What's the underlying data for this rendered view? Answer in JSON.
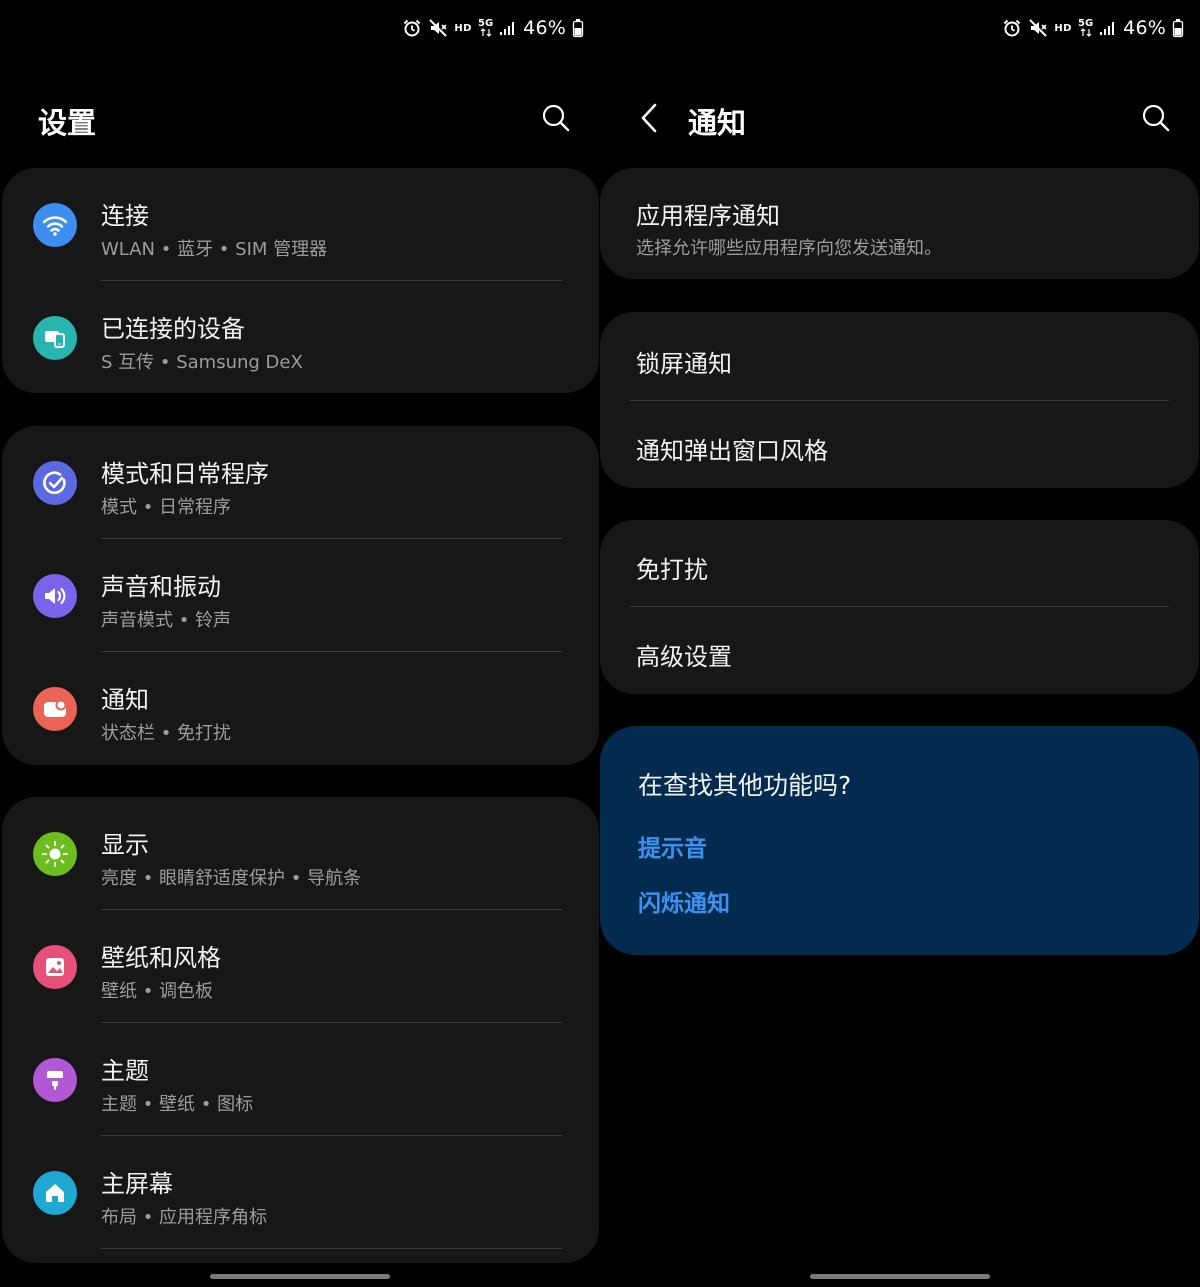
{
  "status_bar": {
    "network_hd": "HD",
    "network_5g": "5G",
    "battery_percent": "46%"
  },
  "settings_screen": {
    "title": "设置",
    "groups": [
      {
        "items": [
          {
            "title": "连接",
            "subtitle": "WLAN  •  蓝牙  •  SIM 管理器",
            "icon": "wifi-icon",
            "icon_color": "#3d8ef0"
          },
          {
            "title": "已连接的设备",
            "subtitle": "S 互传  •  Samsung DeX",
            "icon": "devices-icon",
            "icon_color": "#27b5b0"
          }
        ]
      },
      {
        "items": [
          {
            "title": "模式和日常程序",
            "subtitle": "模式  •  日常程序",
            "icon": "modes-check-icon",
            "icon_color": "#5b6ae0"
          },
          {
            "title": "声音和振动",
            "subtitle": "声音模式  •  铃声",
            "icon": "speaker-icon",
            "icon_color": "#7a63e8"
          },
          {
            "title": "通知",
            "subtitle": "状态栏  •  免打扰",
            "icon": "notification-icon",
            "icon_color": "#ea6456"
          }
        ]
      },
      {
        "items": [
          {
            "title": "显示",
            "subtitle": "亮度  •  眼睛舒适度保护  •  导航条",
            "icon": "sun-icon",
            "icon_color": "#6cbd1f"
          },
          {
            "title": "壁纸和风格",
            "subtitle": "壁纸  •  调色板",
            "icon": "wallpaper-icon",
            "icon_color": "#e6517a"
          },
          {
            "title": "主题",
            "subtitle": "主题  •  壁纸  •  图标",
            "icon": "theme-brush-icon",
            "icon_color": "#b258d4"
          },
          {
            "title": "主屏幕",
            "subtitle": "布局  •  应用程序角标",
            "icon": "home-icon",
            "icon_color": "#1fa9d2"
          }
        ]
      }
    ]
  },
  "notifications_screen": {
    "title": "通知",
    "app_notifications": {
      "title": "应用程序通知",
      "subtitle": "选择允许哪些应用程序向您发送通知。"
    },
    "group_lock": [
      "锁屏通知",
      "通知弹出窗口风格"
    ],
    "group_dnd": [
      "免打扰",
      "高级设置"
    ],
    "suggestions": {
      "question": "在查找其他功能吗?",
      "links": [
        "提示音",
        "闪烁通知"
      ]
    }
  },
  "colors": {
    "background": "#000000",
    "card": "#171717",
    "suggestion_card": "#032b4f",
    "link": "#3e91f0"
  }
}
